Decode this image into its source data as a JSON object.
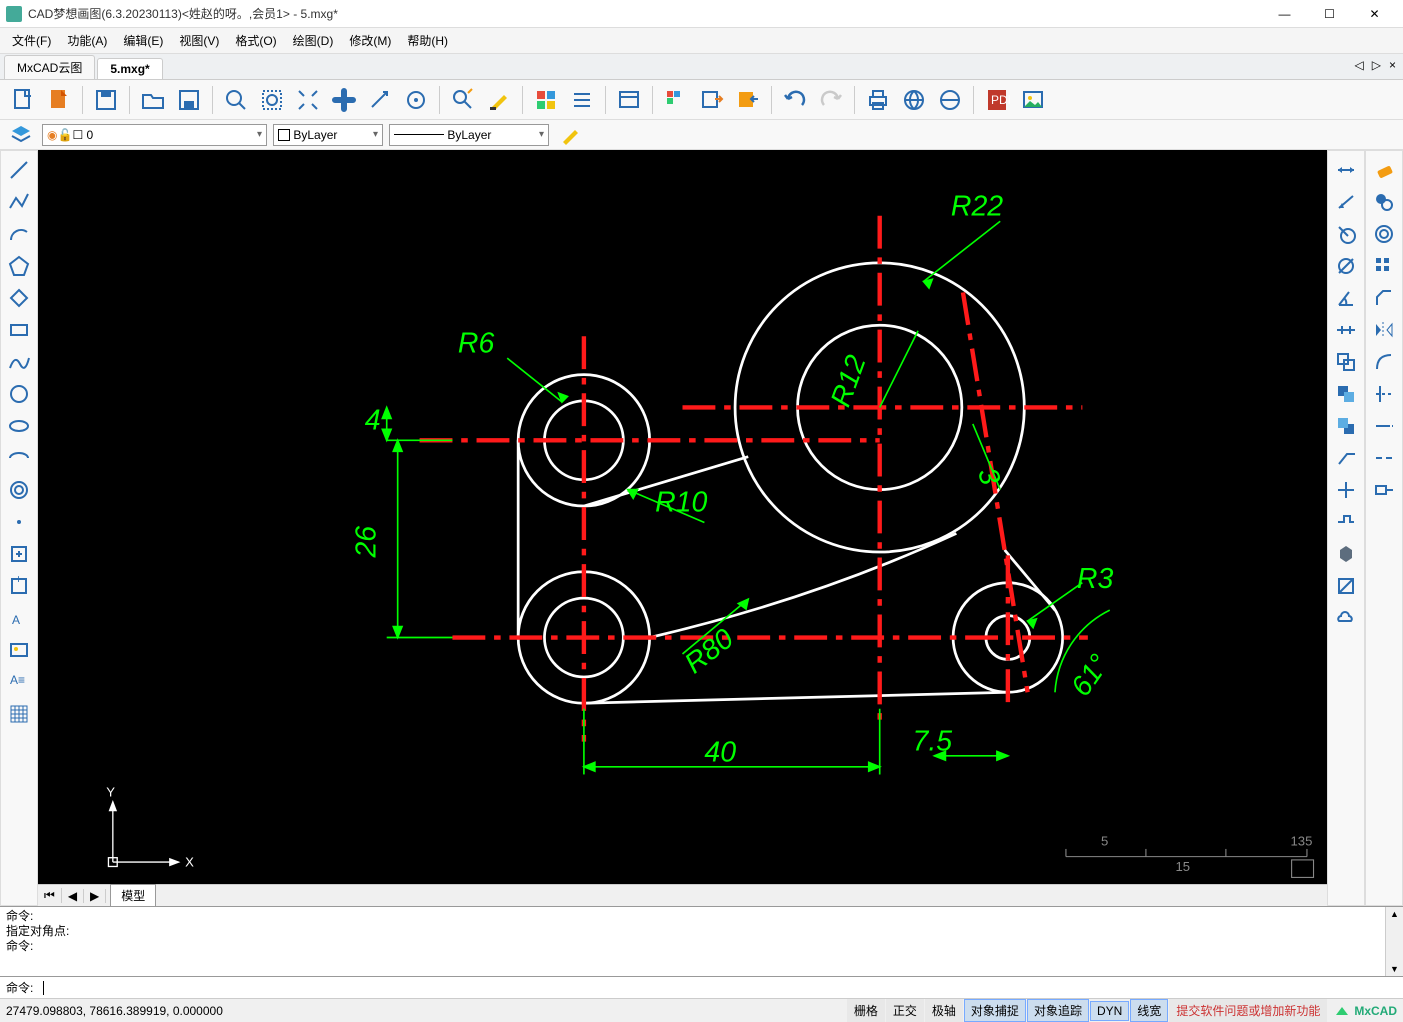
{
  "title": "CAD梦想画图(6.3.20230113)<姓赵的呀。,会员1> - 5.mxg*",
  "menus": [
    "文件(F)",
    "功能(A)",
    "编辑(E)",
    "视图(V)",
    "格式(O)",
    "绘图(D)",
    "修改(M)",
    "帮助(H)"
  ],
  "doc_tabs": [
    {
      "label": "MxCAD云图",
      "active": false
    },
    {
      "label": "5.mxg*",
      "active": true
    }
  ],
  "layer": {
    "value": "0",
    "swatches": "■■□"
  },
  "color_combo": "ByLayer",
  "linetype_combo": "ByLayer",
  "model_tab": "模型",
  "cmd_history": [
    "命令:",
    "指定对角点:",
    "命令:"
  ],
  "cmd_prompt": "命令:",
  "coords": "27479.098803,  78616.389919,  0.000000",
  "status_toggles": [
    {
      "label": "栅格",
      "on": false
    },
    {
      "label": "正交",
      "on": false
    },
    {
      "label": "极轴",
      "on": false
    },
    {
      "label": "对象捕捉",
      "on": true
    },
    {
      "label": "对象追踪",
      "on": true
    },
    {
      "label": "DYN",
      "on": true
    },
    {
      "label": "线宽",
      "on": true
    },
    {
      "label": "提交软件问题或增加新功能",
      "on": false
    }
  ],
  "brand": "MxCAD",
  "drawing": {
    "dims": {
      "r22": "R22",
      "r6": "R6",
      "r12": "R12",
      "r10": "R10",
      "r80": "R80",
      "r3": "R3",
      "d4": "4",
      "d26": "26",
      "d40": "40",
      "d7_5": "7.5",
      "d3": "3",
      "a61": "61°"
    },
    "scale_ticks": {
      "t1": "5",
      "t2": "15",
      "t3": "135"
    },
    "axes": {
      "x": "X",
      "y": "Y"
    }
  }
}
